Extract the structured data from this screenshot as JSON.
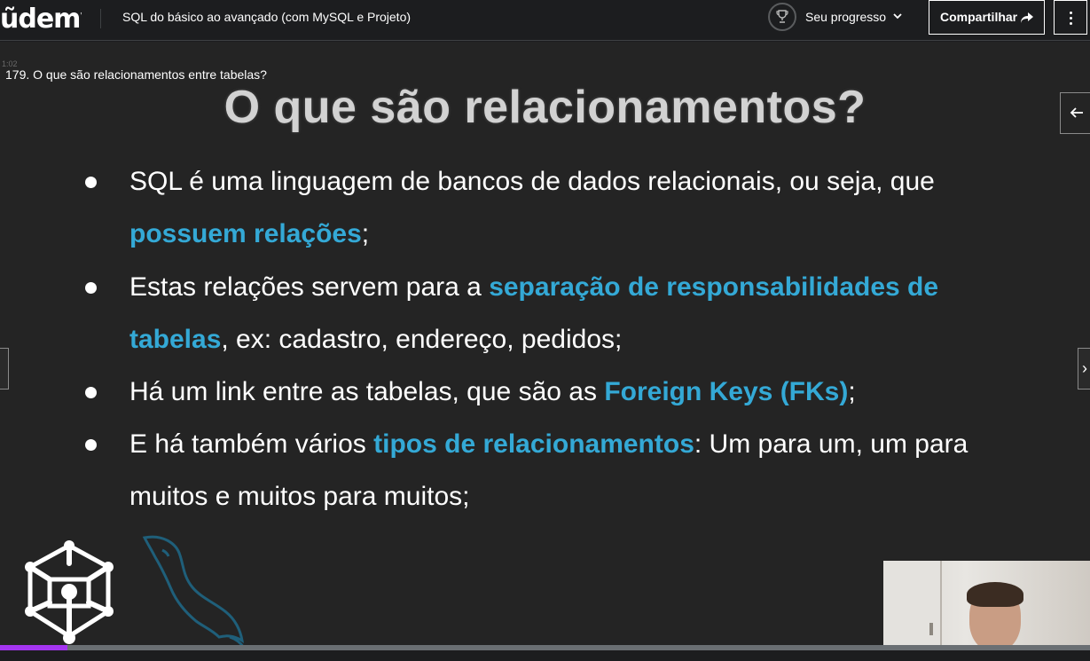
{
  "header": {
    "logo_text": "ũdemy",
    "course_title": "SQL do básico ao avançado (com MySQL e Projeto)",
    "progress_label": "Seu progresso",
    "share_label": "Compartilhar",
    "progress_icon": "trophy-icon",
    "menu_icon": "more-vertical-icon"
  },
  "video": {
    "lecture_title": "179. O que são relacionamentos entre tabelas?",
    "timecode_ghost": "1:02",
    "progress_fraction": 0.062
  },
  "slide": {
    "title": "O que são relacionamentos?",
    "bullets": [
      {
        "line1_pre": "SQL é uma linguagem de bancos de dados relacionais, ou seja, que",
        "line2_hl": "possuem relações",
        "line2_post": ";"
      },
      {
        "line1_pre": "Estas relações servem para a ",
        "line1_hl": "separação de responsabilidades de",
        "line2_hl": "tabelas",
        "line2_post": ", ex: cadastro, endereço, pedidos;"
      },
      {
        "line1_pre": "Há um link entre as tabelas, que são as ",
        "line1_hl": "Foreign Keys (FKs)",
        "line1_post": ";"
      },
      {
        "line1_pre": "E há também vários ",
        "line1_hl": "tipos de relacionamentos",
        "line1_post": ": Um para um, um para",
        "line2_pre": "muitos e muitos para muitos;"
      }
    ],
    "highlight_color": "#34a9d6"
  },
  "colors": {
    "brand_purple": "#a435f0",
    "background": "#1c1d1f"
  }
}
